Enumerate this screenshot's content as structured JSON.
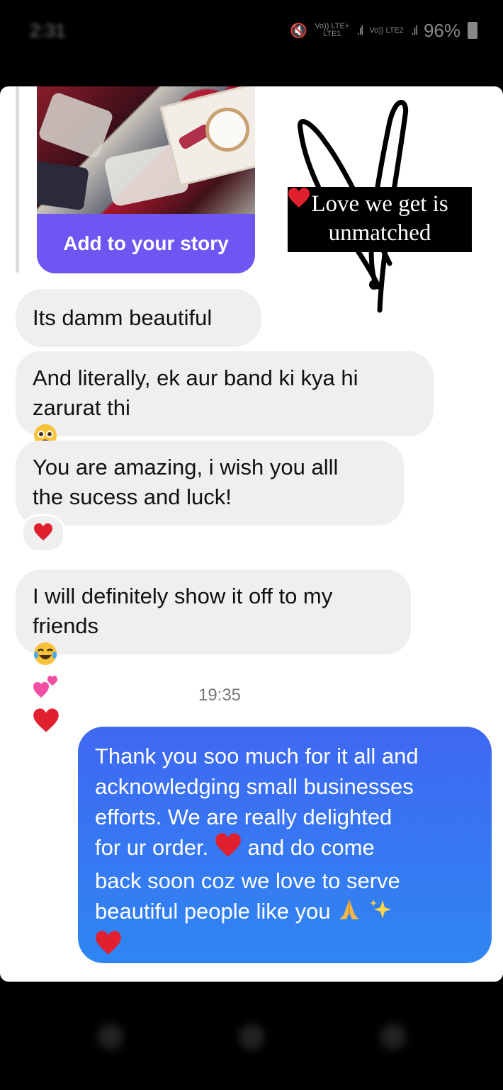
{
  "status_bar": {
    "time": "2:31",
    "network_top": "Vo)) LTE+",
    "network_bottom": "LTE1",
    "network2": "Vo)) LTE2",
    "battery_percent": "96%"
  },
  "story_share": {
    "button_label": "Add to your story"
  },
  "sticker": {
    "text_line1": "Love we get is",
    "text_line2": "unmatched"
  },
  "messages": {
    "m1": "Its damm beautiful",
    "m2_line1": "And literally, ek aur band ki kya hi",
    "m2_line2": "zarurat thi",
    "m3_line1": "You are amazing, i wish you alll",
    "m3_line2": "the sucess and luck!",
    "m4_line1": "I will definitely show it off to my",
    "m4_line2": "friends"
  },
  "timestamp": "19:35",
  "sent_message": {
    "line1": "Thank you soo much for it all and",
    "line2": "acknowledging small businesses",
    "line3": "efforts. We are really delighted",
    "line4": "for ur order.",
    "line4b": "and do come",
    "line5": "back soon coz we love to serve",
    "line6": "beautiful people like you"
  },
  "colors": {
    "sent_bubble": "#3a6ff0",
    "received_bubble": "#efefef",
    "story_button": "#6e56f2",
    "heart": "#e0202e"
  },
  "icons": [
    "heart-icon",
    "pleading-face-icon",
    "laughing-tears-icon",
    "two-hearts-icon",
    "folded-hands-icon",
    "sparkles-icon"
  ]
}
